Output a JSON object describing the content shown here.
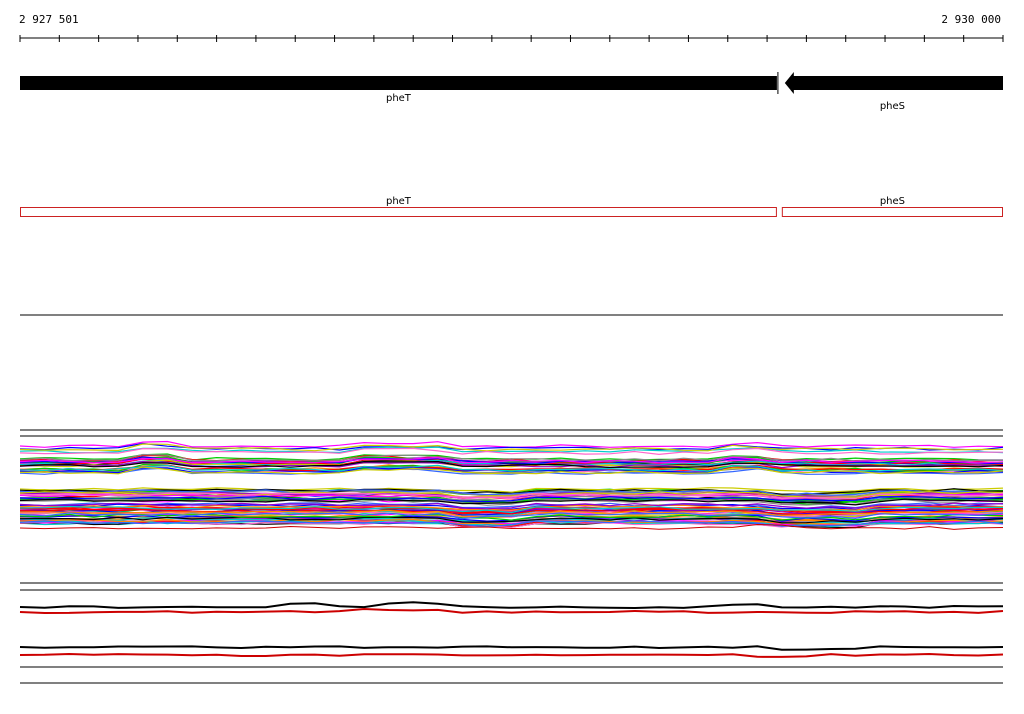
{
  "ruler": {
    "start_label": "2 927 501",
    "end_label": "2 930 000",
    "tick_count": 26
  },
  "genes": [
    {
      "name": "pheT",
      "strand": "+",
      "start_frac": 0.0,
      "end_frac": 0.77
    },
    {
      "name": "pheS",
      "strand": "-",
      "start_frac": 0.775,
      "end_frac": 1.0
    }
  ],
  "colors": {
    "axis": "#000000",
    "gene_arrow": "#000000",
    "cds_box": "#cc2222",
    "reference": "#cc0000"
  },
  "track_palette": [
    "#ff00ff",
    "#00cc00",
    "#0000ff",
    "#ff0000",
    "#00cccc",
    "#cccc00",
    "#ff8800",
    "#9900cc",
    "#888888",
    "#000000",
    "#ff66cc",
    "#3366ff"
  ]
}
